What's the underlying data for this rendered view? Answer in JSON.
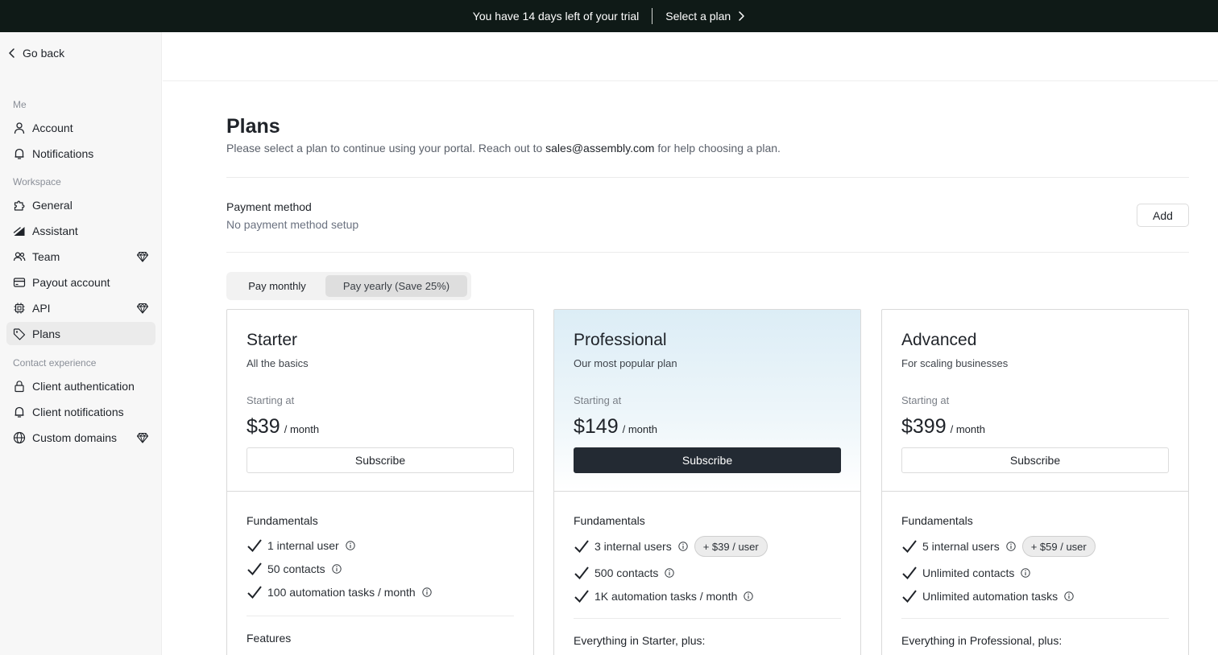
{
  "banner": {
    "trial_text": "You have 14 days left of your trial",
    "cta_label": "Select a plan"
  },
  "sidebar": {
    "go_back": "Go back",
    "sections": {
      "me": "Me",
      "workspace": "Workspace",
      "contact": "Contact experience"
    },
    "items": [
      {
        "label": "Account",
        "icon": "user-icon"
      },
      {
        "label": "Notifications",
        "icon": "bell-icon"
      },
      {
        "label": "General",
        "icon": "puzzle-icon"
      },
      {
        "label": "Assistant",
        "icon": "assistant-icon"
      },
      {
        "label": "Team",
        "icon": "team-icon",
        "premium": true
      },
      {
        "label": "Payout account",
        "icon": "card-icon"
      },
      {
        "label": "API",
        "icon": "chip-icon",
        "premium": true
      },
      {
        "label": "Plans",
        "icon": "tag-icon",
        "active": true
      },
      {
        "label": "Client authentication",
        "icon": "lock-icon"
      },
      {
        "label": "Client notifications",
        "icon": "bell-icon"
      },
      {
        "label": "Custom domains",
        "icon": "globe-icon",
        "premium": true
      }
    ]
  },
  "page": {
    "title": "Plans",
    "desc_before": "Please select a plan to continue using your portal. Reach out to ",
    "desc_email": "sales@assembly.com",
    "desc_after": " for help choosing a plan."
  },
  "payment": {
    "title": "Payment method",
    "subtitle": "No payment method setup",
    "add_label": "Add"
  },
  "billing_toggle": {
    "monthly": "Pay monthly",
    "yearly": "Pay yearly (Save 25%)",
    "selected": "yearly"
  },
  "plans": [
    {
      "name": "Starter",
      "tagline": "All the basics",
      "starting_label": "Starting at",
      "price": "$39",
      "period": "/ month",
      "button": "Subscribe",
      "fundamentals_title": "Fundamentals",
      "features": [
        "1 internal user",
        "50 contacts",
        "100 automation tasks / month"
      ],
      "next_section": "Features"
    },
    {
      "name": "Professional",
      "tagline": "Our most popular plan",
      "starting_label": "Starting at",
      "price": "$149",
      "period": "/ month",
      "button": "Subscribe",
      "fundamentals_title": "Fundamentals",
      "features": [
        "3 internal users",
        "500 contacts",
        "1K automation tasks / month"
      ],
      "user_addon": "+ $39 / user",
      "next_section": "Everything in Starter, plus:"
    },
    {
      "name": "Advanced",
      "tagline": "For scaling businesses",
      "starting_label": "Starting at",
      "price": "$399",
      "period": "/ month",
      "button": "Subscribe",
      "fundamentals_title": "Fundamentals",
      "features": [
        "5 internal users",
        "Unlimited contacts",
        "Unlimited automation tasks"
      ],
      "user_addon": "+ $59 / user",
      "next_section": "Everything in Professional, plus:"
    }
  ],
  "colors": {
    "banner_bg": "#0f1a17",
    "primary_button": "#232a33",
    "featured_gradient": "#dcedf6"
  }
}
